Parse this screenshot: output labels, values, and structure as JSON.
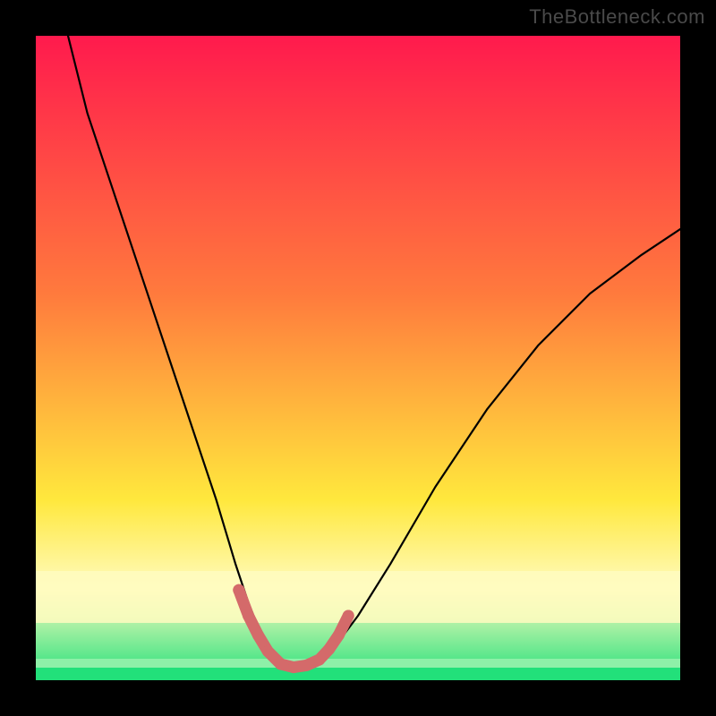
{
  "watermark": "TheBottleneck.com",
  "chart_data": {
    "type": "line",
    "title": "",
    "xlabel": "",
    "ylabel": "",
    "xlim": [
      0,
      100
    ],
    "ylim": [
      0,
      100
    ],
    "grid": false,
    "background_gradient": {
      "top": "#ff1a4d",
      "mid1": "#ff7a3d",
      "mid2": "#ffe83d",
      "band": "#fffbbf",
      "bottom": "#22e07a"
    },
    "series": [
      {
        "name": "bottleneck-curve",
        "color": "#000000",
        "x": [
          5,
          8,
          12,
          16,
          20,
          24,
          28,
          31,
          33,
          35,
          37,
          39,
          41,
          44,
          47,
          50,
          55,
          62,
          70,
          78,
          86,
          94,
          100
        ],
        "y": [
          100,
          88,
          76,
          64,
          52,
          40,
          28,
          18,
          12,
          7,
          4,
          2,
          2,
          3,
          6,
          10,
          18,
          30,
          42,
          52,
          60,
          66,
          70
        ]
      },
      {
        "name": "bottom-markers",
        "color": "#d46a6a",
        "type": "scatter",
        "x": [
          31.5,
          33,
          34.5,
          36,
          38,
          40,
          42,
          44,
          45.5,
          47,
          48.5
        ],
        "y": [
          14,
          10,
          7,
          4.5,
          2.5,
          2,
          2.3,
          3.2,
          4.8,
          7,
          10
        ]
      }
    ]
  }
}
